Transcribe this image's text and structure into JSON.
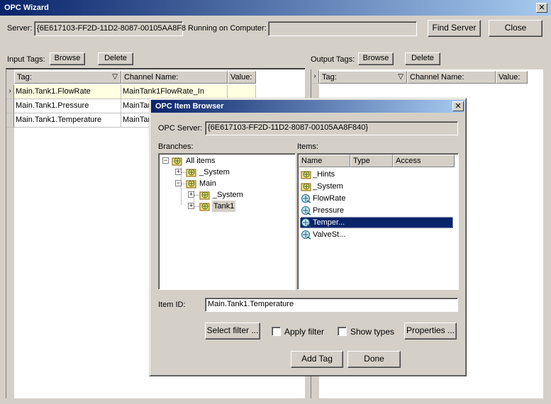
{
  "wizard": {
    "title": "OPC Wizard",
    "server_label": "Server:",
    "server_value": "{6E617103-FF2D-11D2-8087-00105AA8F8",
    "running_label": "Running on Computer:",
    "running_value": "",
    "find_server_label": "Find Server",
    "close_label": "Close",
    "input_tags_label": "Input Tags:",
    "output_tags_label": "Output Tags:",
    "browse_label": "Browse",
    "delete_label": "Delete",
    "input_table": {
      "headers": [
        "Tag:",
        "Channel Name:",
        "Value:"
      ],
      "rows": [
        {
          "tag": "Main.Tank1.FlowRate",
          "channel": "MainTank1FlowRate_In",
          "value": ""
        },
        {
          "tag": "Main.Tank1.Pressure",
          "channel": "MainTar",
          "value": ""
        },
        {
          "tag": "Main.Tank1.Temperature",
          "channel": "MainTar",
          "value": ""
        }
      ]
    },
    "output_table": {
      "headers": [
        "Tag:",
        "Channel Name:",
        "Value:"
      ]
    }
  },
  "browser": {
    "title": "OPC Item Browser",
    "opc_server_label": "OPC Server:",
    "opc_server_value": "{6E617103-FF2D-11D2-8087-00105AA8F840}",
    "branches_label": "Branches:",
    "items_label": "Items:",
    "tree": [
      {
        "label": "All items",
        "level": 0,
        "expander": "−"
      },
      {
        "label": "_System",
        "level": 1,
        "expander": "+"
      },
      {
        "label": "Main",
        "level": 1,
        "expander": "−"
      },
      {
        "label": "_System",
        "level": 2,
        "expander": "+"
      },
      {
        "label": "Tank1",
        "level": 2,
        "expander": "+"
      }
    ],
    "items_headers": [
      "Name",
      "Type",
      "Access"
    ],
    "items": [
      {
        "name": "_Hints",
        "kind": "folder"
      },
      {
        "name": "_System",
        "kind": "folder"
      },
      {
        "name": "FlowRate",
        "kind": "tag"
      },
      {
        "name": "Pressure",
        "kind": "tag"
      },
      {
        "name": "Temper...",
        "kind": "tag",
        "selected": true
      },
      {
        "name": "ValveSt...",
        "kind": "tag"
      }
    ],
    "item_id_label": "Item ID:",
    "item_id_value": "Main.Tank1.Temperature",
    "select_filter_label": "Select filter ...",
    "apply_filter_label": "Apply filter",
    "show_types_label": "Show types",
    "properties_label": "Properties ...",
    "add_tag_label": "Add Tag",
    "done_label": "Done"
  },
  "colors": {
    "title_active": "#0a246a",
    "title_gradient_end": "#a6caf0",
    "selection": "#0a246a",
    "selected_row": "#ffffe1",
    "face": "#d4d0c8"
  }
}
